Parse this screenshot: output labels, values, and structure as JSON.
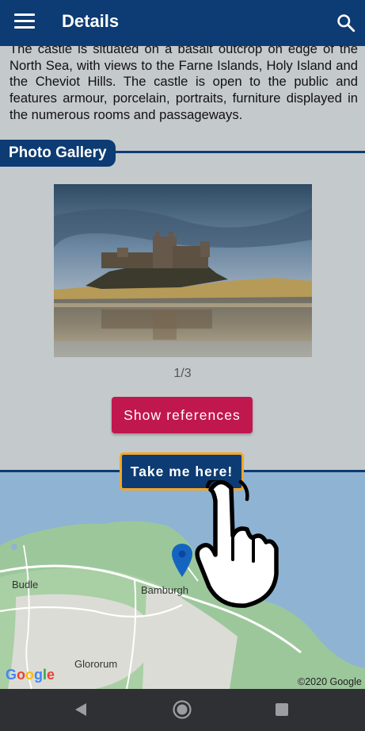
{
  "header": {
    "title": "Details",
    "menu_icon": "hamburger-menu-icon",
    "search_icon": "search-icon",
    "background": "#0d3b73"
  },
  "description": "The castle is situated on a basalt outcrop on edge of the North Sea, with views to the Farne Islands, Holy Island and the Cheviot Hills. The castle is open to the public and features armour, porcelain, portraits, furniture displayed in the numerous rooms and passageways.",
  "gallery": {
    "heading": "Photo Gallery",
    "counter": "1/3"
  },
  "buttons": {
    "show_references": "Show references",
    "take_me_here": "Take me here!"
  },
  "map": {
    "labels": [
      "Budle",
      "Bamburgh",
      "Glororum"
    ],
    "logo": "Google",
    "copyright": "©2020 Google",
    "pin_color": "#1565c0"
  },
  "colors": {
    "accent_pink": "#c0174e",
    "highlight_orange": "#f5a623"
  },
  "navbar": {
    "back_icon": "back-triangle-icon",
    "home_icon": "home-circle-icon",
    "recents_icon": "recents-square-icon"
  }
}
